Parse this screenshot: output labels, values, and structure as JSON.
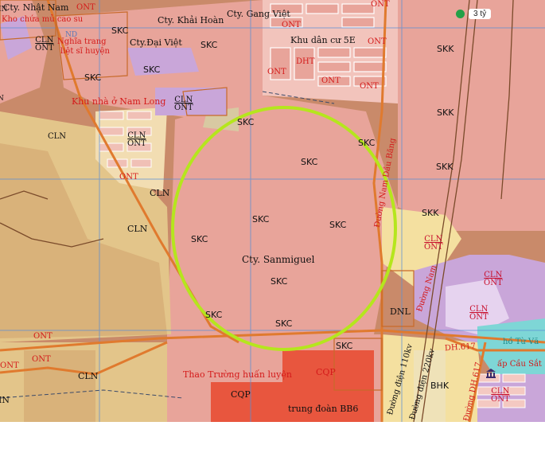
{
  "badge": {
    "price": "3 tỷ",
    "dot_color": "#23a047"
  },
  "highlight": {
    "ellipse_color": "#b5e61d"
  },
  "colors": {
    "skc_industrial": "#e8a49a",
    "clp_agri": "#f4e0a0",
    "ont_residential": "#f0b0a8",
    "road": "#e07a2e",
    "grid_line": "#5a8fd6",
    "cqp_defense": "#e8563e",
    "water": "#7ed6d6",
    "purple_zone": "#c9a6d9"
  },
  "labels": {
    "cty_nhat_nam": "Cty. Nhật Nam",
    "kho_chua_mu": "Kho chứa mủ cao su",
    "nghia_trang": "Nghĩa trang",
    "liet_si": "liệt sĩ huyện",
    "cty_khai_hoan": "Cty. Khải Hoàn",
    "cty_gang_viet": "Cty. Gang Việt",
    "cty_dai_viet": "Cty.Đại Việt",
    "khu_dan_cu_5e": "Khu dân cư 5E",
    "khu_nha_o": "Khu nhà ở Nam Long",
    "cty_sanmiguel": "Cty. Sanmiguel",
    "duong_nam_dau_bang": "Đường Nam Dầu Băng",
    "duong_dien_110": "Đường điện 110kv",
    "duong_dien_220": "Đường điện 220kv",
    "duong_nam_2": "Đường Nam",
    "duong_dh617": "Đường DH.617",
    "dh617": "DH.617",
    "ho_tu": "hồ Từ Vă",
    "cau_sat": "ấp Cầu Sắt",
    "thao_truong": "Thao Trường huấn luyện",
    "trung_doan": "trung đoàn BB6",
    "skc": "SKC",
    "skk": "SKK",
    "cln": "CLN",
    "ont": "ONT",
    "cqp": "CQP",
    "bhk": "BHK",
    "dnl": "DNL",
    "dht": "DHT",
    "nd": "ND",
    "in": "IN",
    "n": "N"
  },
  "icons": {
    "bank": "bank-icon"
  }
}
